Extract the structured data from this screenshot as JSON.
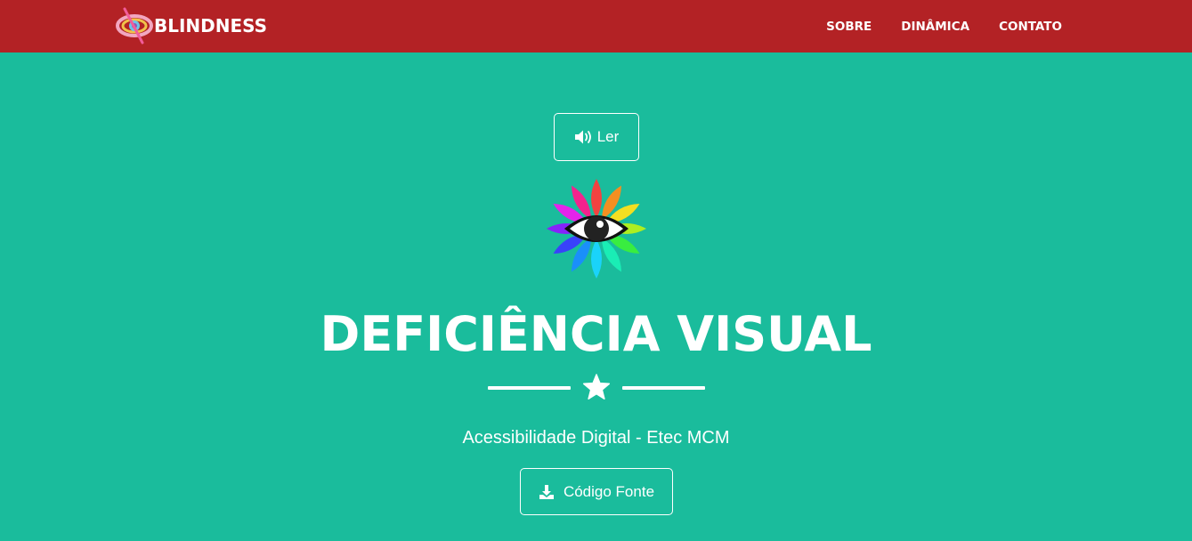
{
  "navbar": {
    "brand": "BLINDNESS",
    "brand_logo_icon": "crossed-eye-logo-icon",
    "links": [
      "SOBRE",
      "DINÂMICA",
      "CONTATO"
    ],
    "background": "#b32225"
  },
  "hero": {
    "read_button": {
      "label": "Ler",
      "icon": "volume-icon"
    },
    "emblem_icon": "rainbow-eye-flower-icon",
    "title": "DEFICIÊNCIA VISUAL",
    "divider_icon": "star-icon",
    "subtitle": "Acessibilidade Digital - Etec MCM",
    "source_button": {
      "label": "Código Fonte",
      "icon": "download-icon"
    },
    "background": "#1abc9c"
  }
}
